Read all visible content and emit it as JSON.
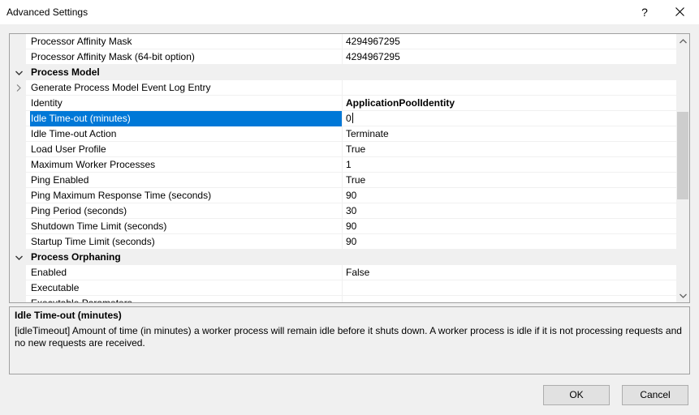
{
  "window": {
    "title": "Advanced Settings",
    "help_label": "?"
  },
  "grid": {
    "rows": [
      {
        "kind": "property",
        "name": "Processor Affinity Mask",
        "value": "4294967295"
      },
      {
        "kind": "property",
        "name": "Processor Affinity Mask (64-bit option)",
        "value": "4294967295"
      },
      {
        "kind": "category",
        "name": "Process Model",
        "expanded": true
      },
      {
        "kind": "property",
        "name": "Generate Process Model Event Log Entry",
        "value": "",
        "expandable": true
      },
      {
        "kind": "property",
        "name": "Identity",
        "value": "ApplicationPoolIdentity",
        "bold": true
      },
      {
        "kind": "property",
        "name": "Idle Time-out (minutes)",
        "value": "0",
        "selected": true
      },
      {
        "kind": "property",
        "name": "Idle Time-out Action",
        "value": "Terminate"
      },
      {
        "kind": "property",
        "name": "Load User Profile",
        "value": "True"
      },
      {
        "kind": "property",
        "name": "Maximum Worker Processes",
        "value": "1"
      },
      {
        "kind": "property",
        "name": "Ping Enabled",
        "value": "True"
      },
      {
        "kind": "property",
        "name": "Ping Maximum Response Time (seconds)",
        "value": "90"
      },
      {
        "kind": "property",
        "name": "Ping Period (seconds)",
        "value": "30"
      },
      {
        "kind": "property",
        "name": "Shutdown Time Limit (seconds)",
        "value": "90"
      },
      {
        "kind": "property",
        "name": "Startup Time Limit (seconds)",
        "value": "90"
      },
      {
        "kind": "category",
        "name": "Process Orphaning",
        "expanded": true
      },
      {
        "kind": "property",
        "name": "Enabled",
        "value": "False"
      },
      {
        "kind": "property",
        "name": "Executable",
        "value": ""
      },
      {
        "kind": "property",
        "name": "Executable Parameters",
        "value": "",
        "partially_visible": true
      }
    ]
  },
  "description": {
    "title": "Idle Time-out (minutes)",
    "text": "[idleTimeout] Amount of time (in minutes) a worker process will remain idle before it shuts down. A worker process is idle if it is not processing requests and no new requests are received."
  },
  "buttons": {
    "ok_label": "OK",
    "cancel_label": "Cancel"
  },
  "colors": {
    "selection": "#0078d7",
    "window_bg": "#f0f0f0",
    "grid_bg": "#ffffff"
  }
}
